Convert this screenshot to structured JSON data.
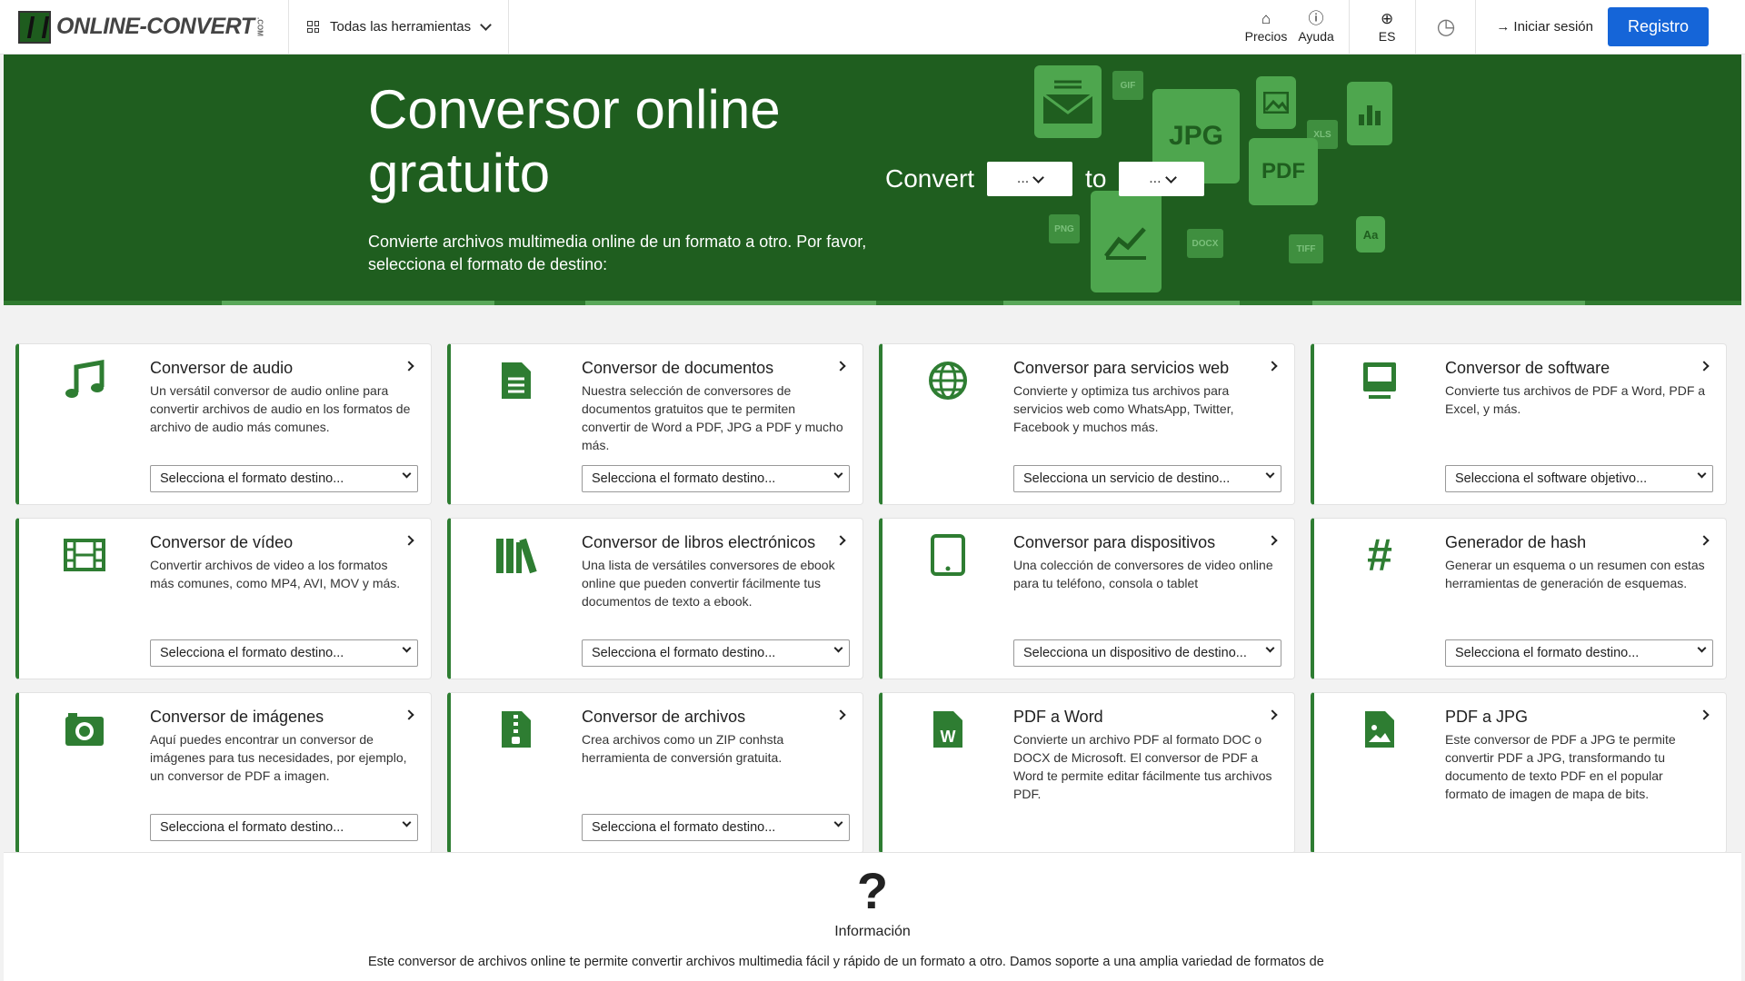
{
  "header": {
    "logo_text": "ONLINE-CONVERT",
    "logo_suffix": ".COM",
    "tools_menu_label": "Todas las herramientas",
    "pricing_label": "Precios",
    "help_label": "Ayuda",
    "language_label": "ES",
    "login_label": "Iniciar sesión",
    "register_label": "Registro"
  },
  "hero": {
    "title": "Conversor online gratuito",
    "subtitle": "Convierte archivos multimedia online de un formato a otro. Por favor, selecciona el formato de destino:",
    "convert_label": "Convert",
    "to_label": "to",
    "from_value": "...",
    "to_value": "...",
    "file_badges": [
      "GIF",
      "JPG",
      "XLS",
      "PDF",
      "PNG",
      "DOCX",
      "TIFF",
      "Aa"
    ]
  },
  "cards": [
    {
      "title": "Conversor de audio",
      "desc": "Un versátil conversor de audio online para convertir archivos de audio en los formatos de archivo de audio más comunes.",
      "select": "Selecciona el formato destino...",
      "icon": "music-note-icon"
    },
    {
      "title": "Conversor de documentos",
      "desc": "Nuestra selección de conversores de documentos gratuitos que te permiten convertir de Word a PDF, JPG a PDF y mucho más.",
      "select": "Selecciona el formato destino...",
      "icon": "document-icon"
    },
    {
      "title": "Conversor para servicios web",
      "desc": "Convierte y optimiza tus archivos para servicios web como WhatsApp, Twitter, Facebook y muchos más.",
      "select": "Selecciona un servicio de destino...",
      "icon": "globe-icon"
    },
    {
      "title": "Conversor de software",
      "desc": "Convierte tus archivos de PDF a Word, PDF a Excel, y más.",
      "select": "Selecciona el software objetivo...",
      "icon": "monitor-icon"
    },
    {
      "title": "Conversor de vídeo",
      "desc": "Convertir archivos de video a los formatos más comunes, como MP4, AVI, MOV y más.",
      "select": "Selecciona el formato destino...",
      "icon": "film-icon"
    },
    {
      "title": "Conversor de libros electrónicos",
      "desc": "Una lista de versátiles conversores de ebook online que pueden convertir fácilmente tus documentos de texto a ebook.",
      "select": "Selecciona el formato destino...",
      "icon": "books-icon"
    },
    {
      "title": "Conversor para dispositivos",
      "desc": "Una colección de conversores de video online para tu teléfono, consola o tablet",
      "select": "Selecciona un dispositivo de destino...",
      "icon": "tablet-icon"
    },
    {
      "title": "Generador de hash",
      "desc": "Generar un esquema o un resumen con estas herramientas de generación de esquemas.",
      "select": "Selecciona el formato destino...",
      "icon": "hash-icon"
    },
    {
      "title": "Conversor de imágenes",
      "desc": "Aquí puedes encontrar un conversor de imágenes para tus necesidades, por ejemplo, un conversor de PDF a imagen.",
      "select": "Selecciona el formato destino...",
      "icon": "camera-icon"
    },
    {
      "title": "Conversor de archivos",
      "desc": "Crea archivos como un ZIP conhsta herramienta de conversión gratuita.",
      "select": "Selecciona el formato destino...",
      "icon": "zip-file-icon"
    },
    {
      "title": "PDF a Word",
      "desc": "Convierte un archivo PDF al formato DOC o DOCX de Microsoft. El conversor de PDF a Word te permite editar fácilmente tus archivos PDF.",
      "select": "",
      "icon": "word-file-icon"
    },
    {
      "title": "PDF a JPG",
      "desc": "Este conversor de PDF a JPG te permite convertir PDF a JPG, transformando tu documento de texto PDF en el popular formato de imagen de mapa de bits.",
      "select": "",
      "icon": "image-file-icon"
    }
  ],
  "info": {
    "label": "Información",
    "text": "Este conversor de archivos online te permite convertir archivos multimedia fácil y rápido de un formato a otro. Damos soporte a una amplia variedad de formatos de"
  }
}
